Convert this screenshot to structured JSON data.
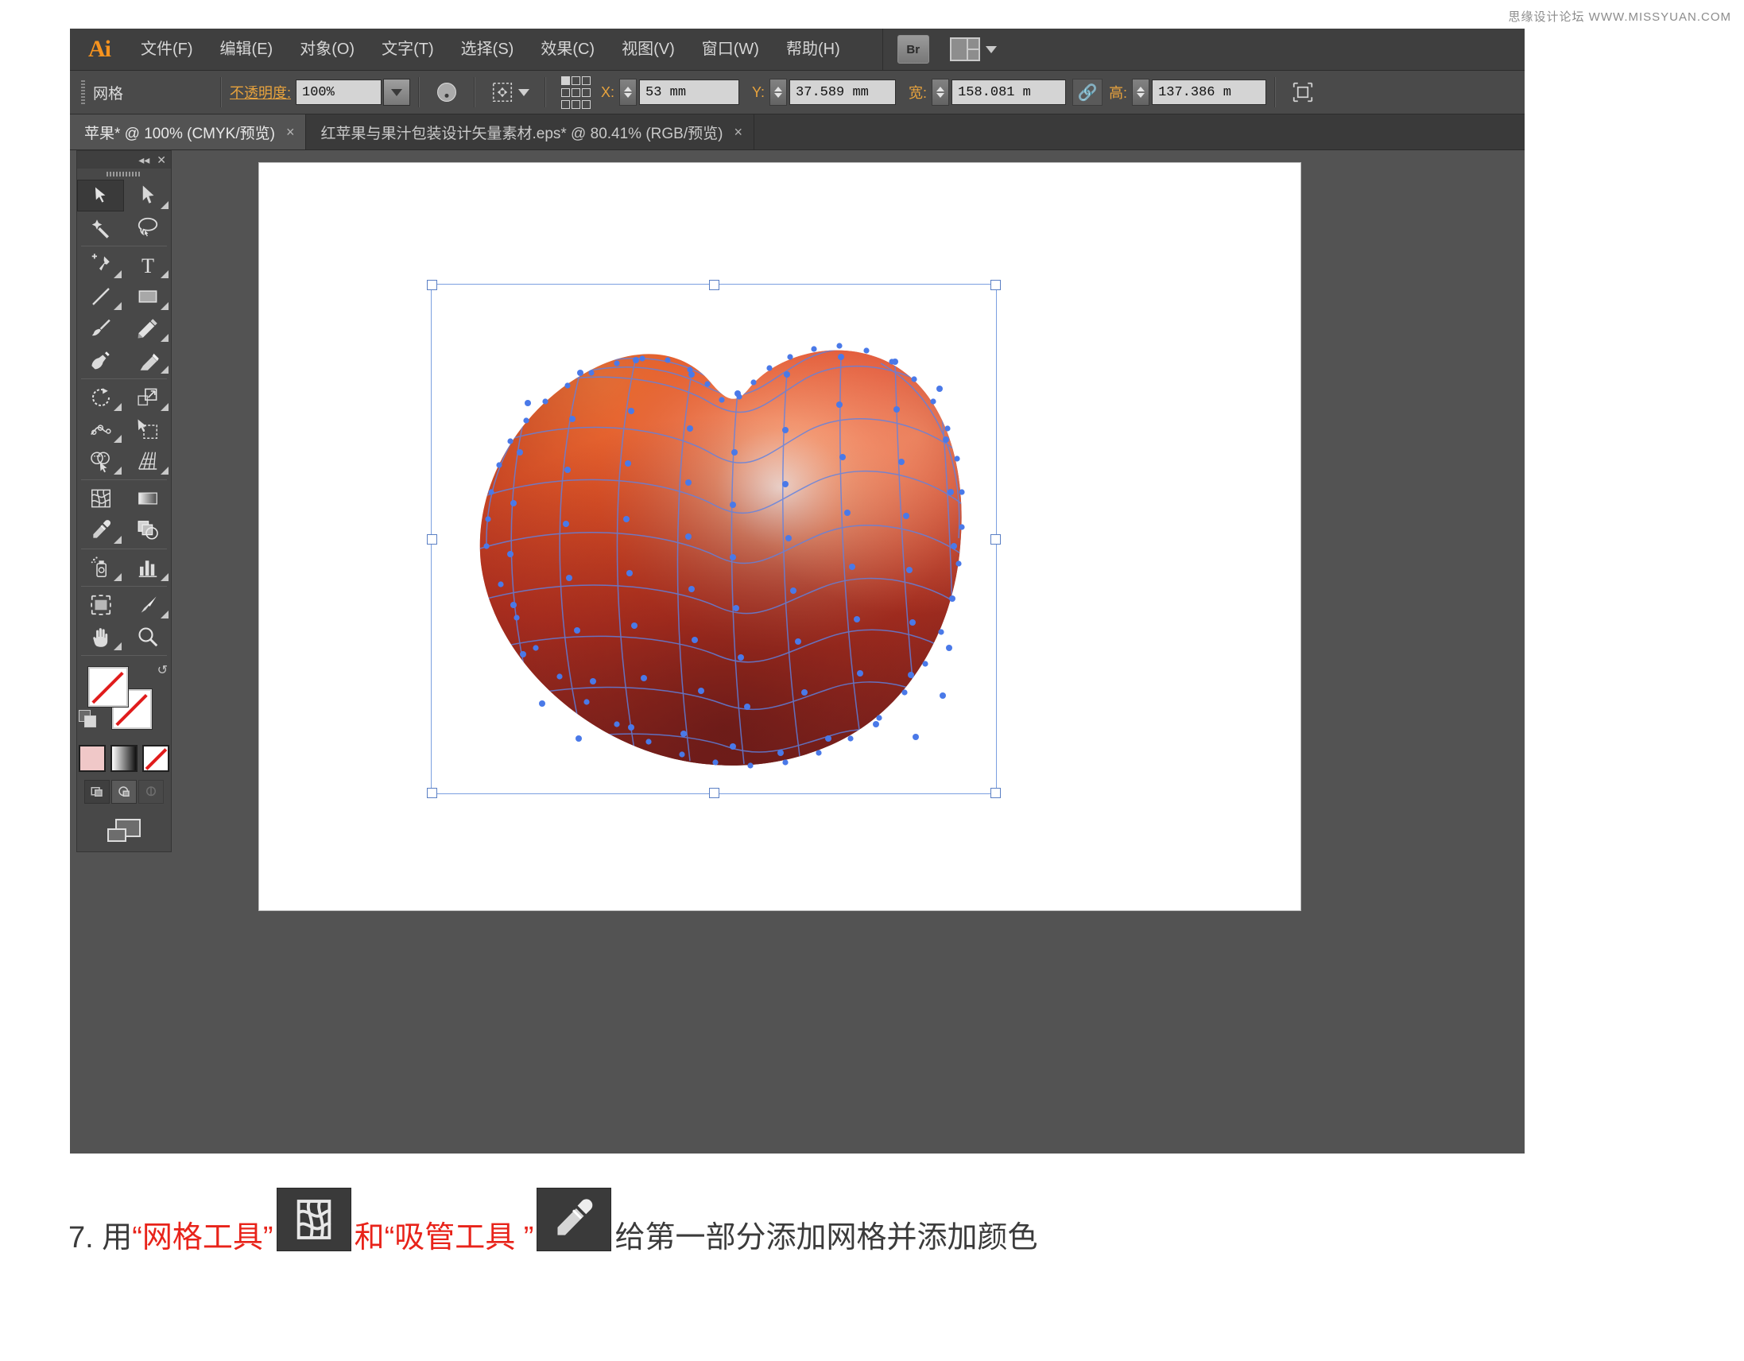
{
  "watermark": "思缘设计论坛  WWW.MISSYUAN.COM",
  "app": {
    "logo": "Ai",
    "name": "Adobe Illustrator"
  },
  "menu": {
    "items": [
      {
        "label": "文件(F)",
        "name": "file"
      },
      {
        "label": "编辑(E)",
        "name": "edit"
      },
      {
        "label": "对象(O)",
        "name": "object"
      },
      {
        "label": "文字(T)",
        "name": "type"
      },
      {
        "label": "选择(S)",
        "name": "select"
      },
      {
        "label": "效果(C)",
        "name": "effect"
      },
      {
        "label": "视图(V)",
        "name": "view"
      },
      {
        "label": "窗口(W)",
        "name": "window"
      },
      {
        "label": "帮助(H)",
        "name": "help"
      }
    ],
    "bridge_label": "Br",
    "workspace_icon": "workspace-switcher-icon"
  },
  "control_bar": {
    "object_type": "网格",
    "opacity_label": "不透明度:",
    "opacity_value": "100%",
    "opacity_mode_icon": "opacity-mode-icon",
    "align_icon": "align-transform-icon",
    "reference_point_icon": "reference-point-grid",
    "x_label": "X:",
    "x_value": "53 mm",
    "y_label": "Y:",
    "y_value": "37.589 mm",
    "width_label": "宽:",
    "width_value": "158.081 m",
    "link_icon": "link-proportions-icon",
    "height_label": "高:",
    "height_value": "137.386 m",
    "transform_icon": "bounding-box-icon"
  },
  "doc_tabs": [
    {
      "label": "苹果* @ 100% (CMYK/预览)",
      "active": true,
      "close": "×"
    },
    {
      "label": "红苹果与果汁包装设计矢量素材.eps* @ 80.41% (RGB/预览)",
      "active": false,
      "close": "×"
    }
  ],
  "tool_panel": {
    "collapse_icon": "collapse-chevrons-icon",
    "close_icon": "close-icon",
    "tools": [
      {
        "name": "selection-tool",
        "selected": true,
        "flyout": false
      },
      {
        "name": "direct-selection-tool",
        "selected": false,
        "flyout": true
      },
      {
        "name": "magic-wand-tool",
        "selected": false,
        "flyout": false
      },
      {
        "name": "lasso-tool",
        "selected": false,
        "flyout": false
      },
      {
        "name": "pen-tool",
        "selected": false,
        "flyout": true
      },
      {
        "name": "type-tool",
        "selected": false,
        "flyout": true
      },
      {
        "name": "line-segment-tool",
        "selected": false,
        "flyout": true
      },
      {
        "name": "rectangle-tool",
        "selected": false,
        "flyout": true
      },
      {
        "name": "paintbrush-tool",
        "selected": false,
        "flyout": false
      },
      {
        "name": "pencil-tool",
        "selected": false,
        "flyout": true
      },
      {
        "name": "blob-brush-tool",
        "selected": false,
        "flyout": false
      },
      {
        "name": "eraser-tool",
        "selected": false,
        "flyout": true
      },
      {
        "name": "rotate-tool",
        "selected": false,
        "flyout": true
      },
      {
        "name": "scale-tool",
        "selected": false,
        "flyout": true
      },
      {
        "name": "width-warp-tool",
        "selected": false,
        "flyout": true
      },
      {
        "name": "free-transform-tool",
        "selected": false,
        "flyout": false
      },
      {
        "name": "shape-builder-tool",
        "selected": false,
        "flyout": true
      },
      {
        "name": "perspective-grid-tool",
        "selected": false,
        "flyout": true
      },
      {
        "name": "mesh-tool",
        "selected": false,
        "flyout": false
      },
      {
        "name": "gradient-tool",
        "selected": false,
        "flyout": false
      },
      {
        "name": "eyedropper-tool",
        "selected": false,
        "flyout": true
      },
      {
        "name": "blend-tool",
        "selected": false,
        "flyout": false
      },
      {
        "name": "symbol-sprayer-tool",
        "selected": false,
        "flyout": true
      },
      {
        "name": "column-graph-tool",
        "selected": false,
        "flyout": true
      },
      {
        "name": "artboard-tool",
        "selected": false,
        "flyout": false
      },
      {
        "name": "slice-tool",
        "selected": false,
        "flyout": true
      },
      {
        "name": "hand-tool",
        "selected": false,
        "flyout": true
      },
      {
        "name": "zoom-tool",
        "selected": false,
        "flyout": false
      }
    ],
    "fill_state": "none",
    "stroke_state": "none",
    "help_glyph": "?",
    "swap_icon": "swap-fill-stroke-icon",
    "default_icon": "default-fill-stroke-icon",
    "modes": [
      {
        "name": "color-mode",
        "type": "color"
      },
      {
        "name": "gradient-mode",
        "type": "gradient"
      },
      {
        "name": "none-mode",
        "type": "none"
      }
    ],
    "screen_modes": [
      {
        "name": "normal-screen-mode"
      },
      {
        "name": "full-screen-menubar-mode"
      },
      {
        "name": "full-screen-mode"
      }
    ],
    "arrange_icon": "arrange-documents-icon"
  },
  "canvas": {
    "artwork_name": "apple-gradient-mesh",
    "mesh_color_light": "#f58a3c",
    "mesh_color_mid": "#e2401f",
    "mesh_color_dark": "#7d1f1c",
    "mesh_line_color": "#5a7fe0",
    "selection_color": "#7b9fe0"
  },
  "caption": {
    "step_number": "7. 用 ",
    "tool1_quoted": "“网格工具”",
    "tool1_icon": "mesh-tool-icon",
    "conjunction": "和 ",
    "tool2_quoted": "“吸管工具 ”",
    "tool2_icon": "eyedropper-tool-icon",
    "tail": "给第一部分添加网格并添加颜色"
  }
}
